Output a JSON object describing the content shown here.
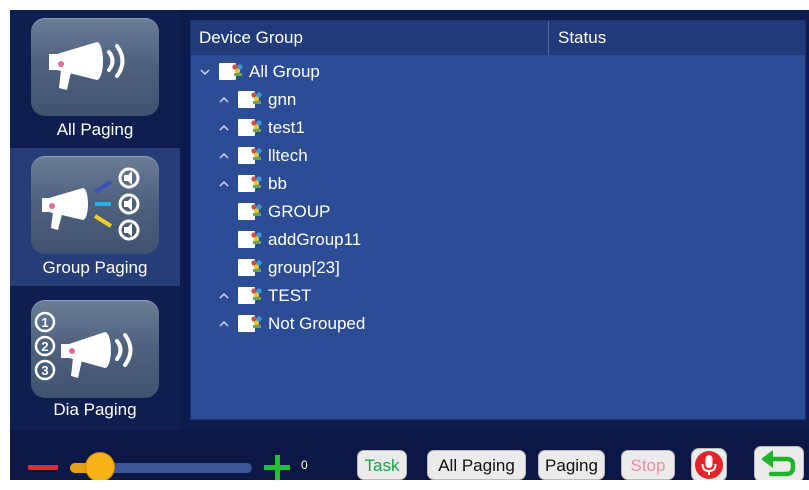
{
  "sidebar": {
    "items": [
      {
        "label": "All Paging",
        "icon": "megaphone-icon",
        "active": false
      },
      {
        "label": "Group Paging",
        "icon": "group-megaphone-icon",
        "active": true
      },
      {
        "label": "Dia Paging",
        "icon": "numbered-megaphone-icon",
        "active": false
      }
    ]
  },
  "table": {
    "columns": [
      "Device Group",
      "Status"
    ],
    "rows": [
      {
        "label": "All Group",
        "expander": "down",
        "level": 0
      },
      {
        "label": "gnn",
        "expander": "up",
        "level": 1
      },
      {
        "label": "test1",
        "expander": "up",
        "level": 1
      },
      {
        "label": "lltech",
        "expander": "up",
        "level": 1
      },
      {
        "label": "bb",
        "expander": "up",
        "level": 1
      },
      {
        "label": "GROUP",
        "expander": "none",
        "level": 1
      },
      {
        "label": "addGroup11",
        "expander": "none",
        "level": 1
      },
      {
        "label": "group[23]",
        "expander": "none",
        "level": 1
      },
      {
        "label": "TEST",
        "expander": "up",
        "level": 1
      },
      {
        "label": "Not Grouped",
        "expander": "up",
        "level": 1
      }
    ]
  },
  "toolbar": {
    "volume_value": "0",
    "volume_level": 0.1,
    "task_label": "Task",
    "all_paging_label": "All Paging",
    "paging_label": "Paging",
    "stop_label": "Stop"
  },
  "colors": {
    "background": "#0c1c4e",
    "panel": "#2c4d95",
    "accent_green": "#21c22b",
    "accent_red": "#e62a33",
    "slider": "#f7b318"
  }
}
